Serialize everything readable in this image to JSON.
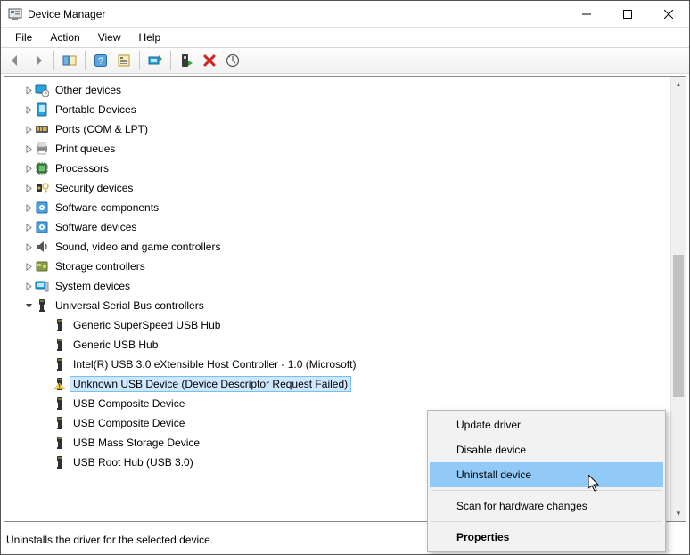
{
  "window": {
    "title": "Device Manager"
  },
  "menu": {
    "file": "File",
    "action": "Action",
    "view": "View",
    "help": "Help"
  },
  "toolbar": {
    "back": "Back",
    "forward": "Forward",
    "show_hide": "Show/Hide Console Tree",
    "help": "Help",
    "properties": "Properties",
    "update": "Update Driver",
    "enable": "Enable Device",
    "uninstall": "Uninstall Device",
    "scan": "Scan for hardware changes"
  },
  "tree": [
    {
      "label": "Other devices",
      "icon": "monitor-question",
      "depth": 1,
      "twisty": "closed"
    },
    {
      "label": "Portable Devices",
      "icon": "device-blue",
      "depth": 1,
      "twisty": "closed"
    },
    {
      "label": "Ports (COM & LPT)",
      "icon": "port",
      "depth": 1,
      "twisty": "closed"
    },
    {
      "label": "Print queues",
      "icon": "printer",
      "depth": 1,
      "twisty": "closed"
    },
    {
      "label": "Processors",
      "icon": "cpu",
      "depth": 1,
      "twisty": "closed"
    },
    {
      "label": "Security devices",
      "icon": "key",
      "depth": 1,
      "twisty": "closed"
    },
    {
      "label": "Software components",
      "icon": "component",
      "depth": 1,
      "twisty": "closed"
    },
    {
      "label": "Software devices",
      "icon": "component",
      "depth": 1,
      "twisty": "closed"
    },
    {
      "label": "Sound, video and game controllers",
      "icon": "speaker",
      "depth": 1,
      "twisty": "closed"
    },
    {
      "label": "Storage controllers",
      "icon": "storage",
      "depth": 1,
      "twisty": "closed"
    },
    {
      "label": "System devices",
      "icon": "system",
      "depth": 1,
      "twisty": "closed"
    },
    {
      "label": "Universal Serial Bus controllers",
      "icon": "usb",
      "depth": 1,
      "twisty": "open"
    },
    {
      "label": "Generic SuperSpeed USB Hub",
      "icon": "usb",
      "depth": 2,
      "twisty": "none"
    },
    {
      "label": "Generic USB Hub",
      "icon": "usb",
      "depth": 2,
      "twisty": "none"
    },
    {
      "label": "Intel(R) USB 3.0 eXtensible Host Controller - 1.0 (Microsoft)",
      "icon": "usb",
      "depth": 2,
      "twisty": "none"
    },
    {
      "label": "Unknown USB Device (Device Descriptor Request Failed)",
      "icon": "usb-warning",
      "depth": 2,
      "twisty": "none",
      "selected": true
    },
    {
      "label": "USB Composite Device",
      "icon": "usb",
      "depth": 2,
      "twisty": "none"
    },
    {
      "label": "USB Composite Device",
      "icon": "usb",
      "depth": 2,
      "twisty": "none"
    },
    {
      "label": "USB Mass Storage Device",
      "icon": "usb",
      "depth": 2,
      "twisty": "none"
    },
    {
      "label": "USB Root Hub (USB 3.0)",
      "icon": "usb",
      "depth": 2,
      "twisty": "none"
    }
  ],
  "context_menu": {
    "update_driver": "Update driver",
    "disable_device": "Disable device",
    "uninstall_device": "Uninstall device",
    "scan_changes": "Scan for hardware changes",
    "properties": "Properties"
  },
  "status": "Uninstalls the driver for the selected device."
}
